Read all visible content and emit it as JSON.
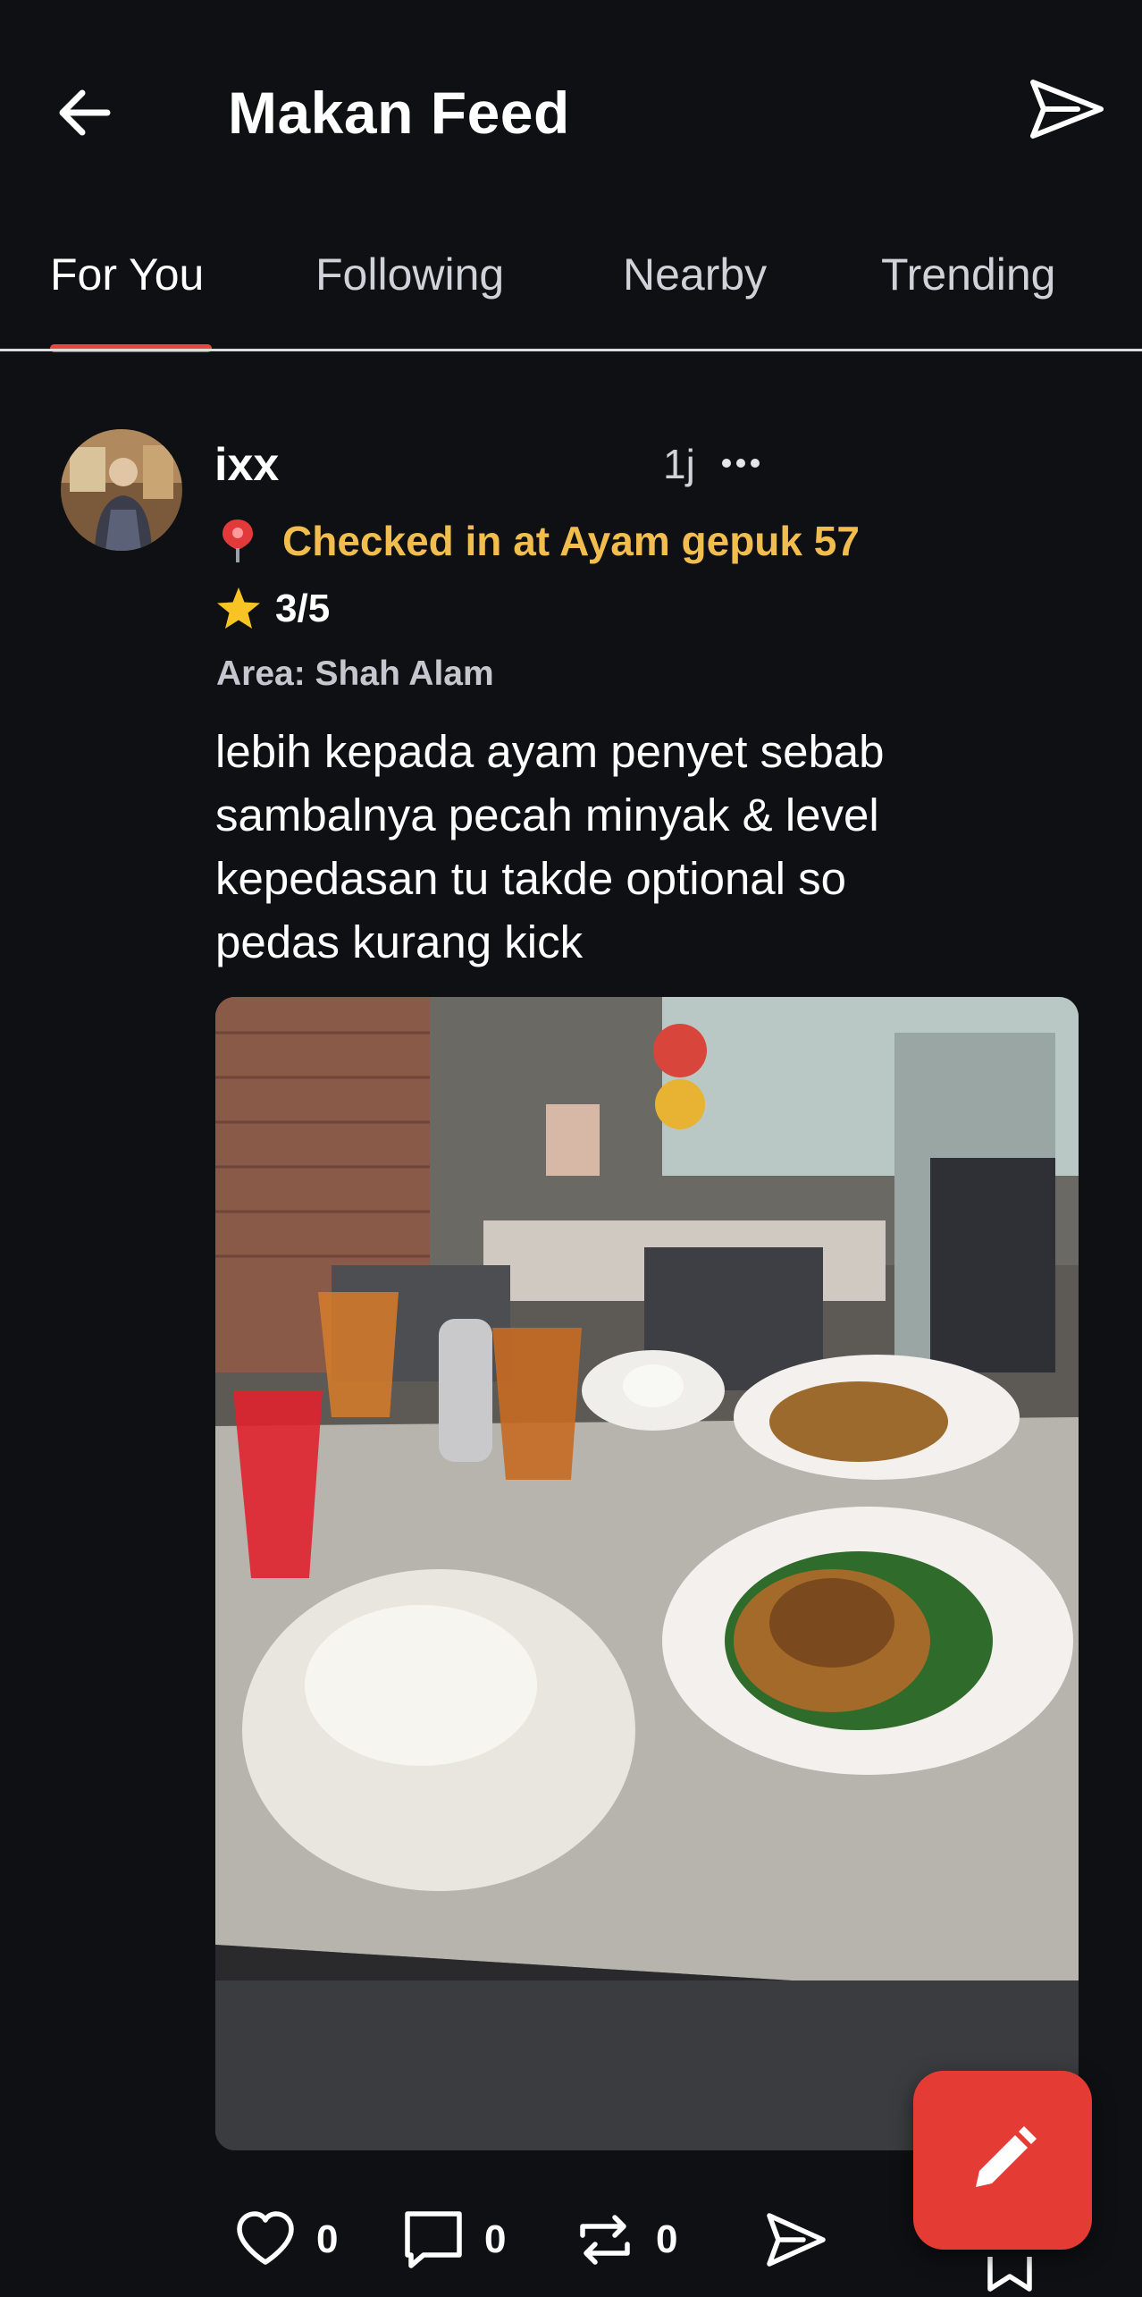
{
  "header": {
    "title": "Makan Feed",
    "back_icon": "arrow-left-icon",
    "send_icon": "send-icon"
  },
  "tabs": [
    {
      "label": "For You",
      "active": true
    },
    {
      "label": "Following",
      "active": false
    },
    {
      "label": "Nearby",
      "active": false
    },
    {
      "label": "Trending",
      "active": false
    }
  ],
  "post": {
    "username": "ixx",
    "time": "1j",
    "checkin": "Checked in at Ayam gepuk 57",
    "rating": "3/5",
    "area": "Area: Shah Alam",
    "text": "lebih kepada ayam penyet sebab\nsambalnya pecah minyak & level\nkepedasan tu takde optional so\npedas kurang kick",
    "likes": "0",
    "comments": "0",
    "reposts": "0"
  },
  "colors": {
    "background": "#0f1014",
    "accent": "#e5483d",
    "checkin": "#f1bd4e",
    "fab": "#e43b34"
  }
}
